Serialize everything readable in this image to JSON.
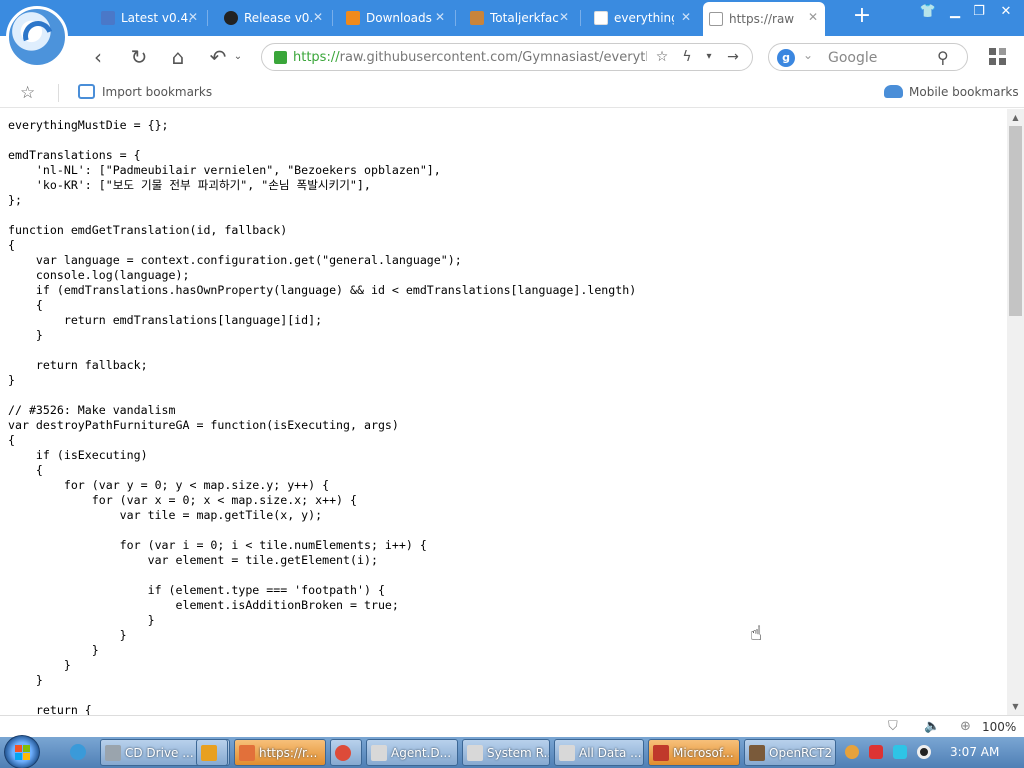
{
  "tabs": [
    {
      "label": "Latest v0.4.",
      "icon": "package-icon",
      "color": "#4a78c8"
    },
    {
      "label": "Release v0.",
      "icon": "github-icon",
      "color": "#222222"
    },
    {
      "label": "Downloads",
      "icon": "download-icon",
      "color": "#f08a1c"
    },
    {
      "label": "Totaljerkfac",
      "icon": "face-icon",
      "color": "#c8843c"
    },
    {
      "label": "everything",
      "icon": "document-icon",
      "color": "#ffffff"
    },
    {
      "label": "https://raw",
      "icon": "document-icon",
      "color": "#888888",
      "active": true
    }
  ],
  "address": {
    "scheme": "https://",
    "rest": "raw.githubusercontent.com/Gymnasiast/everythin"
  },
  "search": {
    "placeholder": "Google",
    "engine_badge": "g"
  },
  "bookmarks": {
    "import_label": "Import bookmarks",
    "mobile_label": "Mobile bookmarks"
  },
  "code": "everythingMustDie = {};\n\nemdTranslations = {\n    'nl-NL': [\"Padmeubilair vernielen\", \"Bezoekers opblazen\"],\n    'ko-KR': [\"보도 기물 전부 파괴하기\", \"손님 폭발시키기\"],\n};\n\nfunction emdGetTranslation(id, fallback)\n{\n    var language = context.configuration.get(\"general.language\");\n    console.log(language);\n    if (emdTranslations.hasOwnProperty(language) && id < emdTranslations[language].length)\n    {\n        return emdTranslations[language][id];\n    }\n\n    return fallback;\n}\n\n// #3526: Make vandalism\nvar destroyPathFurnitureGA = function(isExecuting, args)\n{\n    if (isExecuting)\n    {\n        for (var y = 0; y < map.size.y; y++) {\n            for (var x = 0; x < map.size.x; x++) {\n                var tile = map.getTile(x, y);\n\n                for (var i = 0; i < tile.numElements; i++) {\n                    var element = tile.getElement(i);\n\n                    if (element.type === 'footpath') {\n                        element.isAdditionBroken = true;\n                    }\n                }\n            }\n        }\n    }\n\n    return {",
  "status": {
    "zoom": "100%"
  },
  "taskbar": {
    "items": [
      {
        "label": "CD Drive ...",
        "color": "#9aa4ad"
      },
      {
        "label": "",
        "color": "#e8a020"
      },
      {
        "label": "https://r...",
        "color": "#e2703a",
        "active": true
      },
      {
        "label": "",
        "color": "#dd4b39"
      },
      {
        "label": "Agent.D...",
        "color": "#d8d8d8"
      },
      {
        "label": "System R...",
        "color": "#d8d8d8"
      },
      {
        "label": "All Data ...",
        "color": "#d8d8d8"
      },
      {
        "label": "Microsof...",
        "color": "#c0392b",
        "active": true
      },
      {
        "label": "OpenRCT2",
        "color": "#7a5a3a"
      }
    ],
    "clock": "3:07 AM"
  }
}
